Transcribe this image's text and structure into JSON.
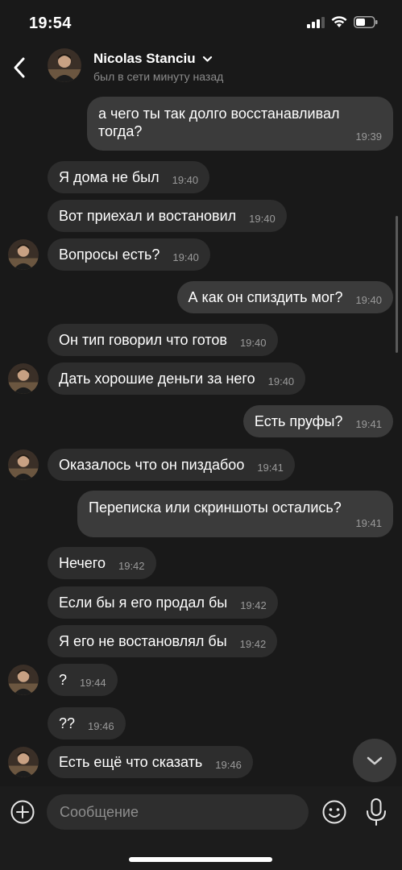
{
  "status_bar": {
    "time": "19:54"
  },
  "header": {
    "contact_name": "Nicolas Stanciu",
    "contact_status": "был в сети минуту назад"
  },
  "messages": [
    {
      "dir": "out",
      "text": "а чего ты так долго восстанавливал тогда?",
      "time": "19:39"
    },
    {
      "dir": "in",
      "text": "Я дома не был",
      "time": "19:40"
    },
    {
      "dir": "in",
      "text": "Вот приехал и востановил",
      "time": "19:40"
    },
    {
      "dir": "in",
      "text": "Вопросы есть?",
      "time": "19:40"
    },
    {
      "dir": "out",
      "text": "А как он спиздить мог?",
      "time": "19:40"
    },
    {
      "dir": "in",
      "text": "Он тип говорил что готов",
      "time": "19:40"
    },
    {
      "dir": "in",
      "text": "Дать хорошие деньги за него",
      "time": "19:40"
    },
    {
      "dir": "out",
      "text": "Есть пруфы?",
      "time": "19:41"
    },
    {
      "dir": "in",
      "text": "Оказалось что он пиздабоо",
      "time": "19:41"
    },
    {
      "dir": "out",
      "text": "Переписка или скриншоты остались?",
      "time": "19:41"
    },
    {
      "dir": "in",
      "text": "Нечего",
      "time": "19:42"
    },
    {
      "dir": "in",
      "text": "Если бы я его продал бы",
      "time": "19:42"
    },
    {
      "dir": "in",
      "text": "Я его не востановлял бы",
      "time": "19:42"
    },
    {
      "dir": "in",
      "text": "?",
      "time": "19:44"
    },
    {
      "dir": "in",
      "text": "??",
      "time": "19:46"
    },
    {
      "dir": "in",
      "text": "Есть ещё что сказать",
      "time": "19:46"
    }
  ],
  "composer": {
    "placeholder": "Сообщение"
  },
  "icons": {
    "back": "chevron-left-icon",
    "expand": "chevron-down-icon",
    "add": "plus-circle-icon",
    "emoji": "smiley-icon",
    "mic": "microphone-icon",
    "scroll_down": "chevron-down-icon"
  },
  "colors": {
    "background": "#191919",
    "incoming_bubble": "#2d2d2d",
    "outgoing_bubble": "#3b3b3b",
    "timestamp": "#9a9a9a"
  }
}
